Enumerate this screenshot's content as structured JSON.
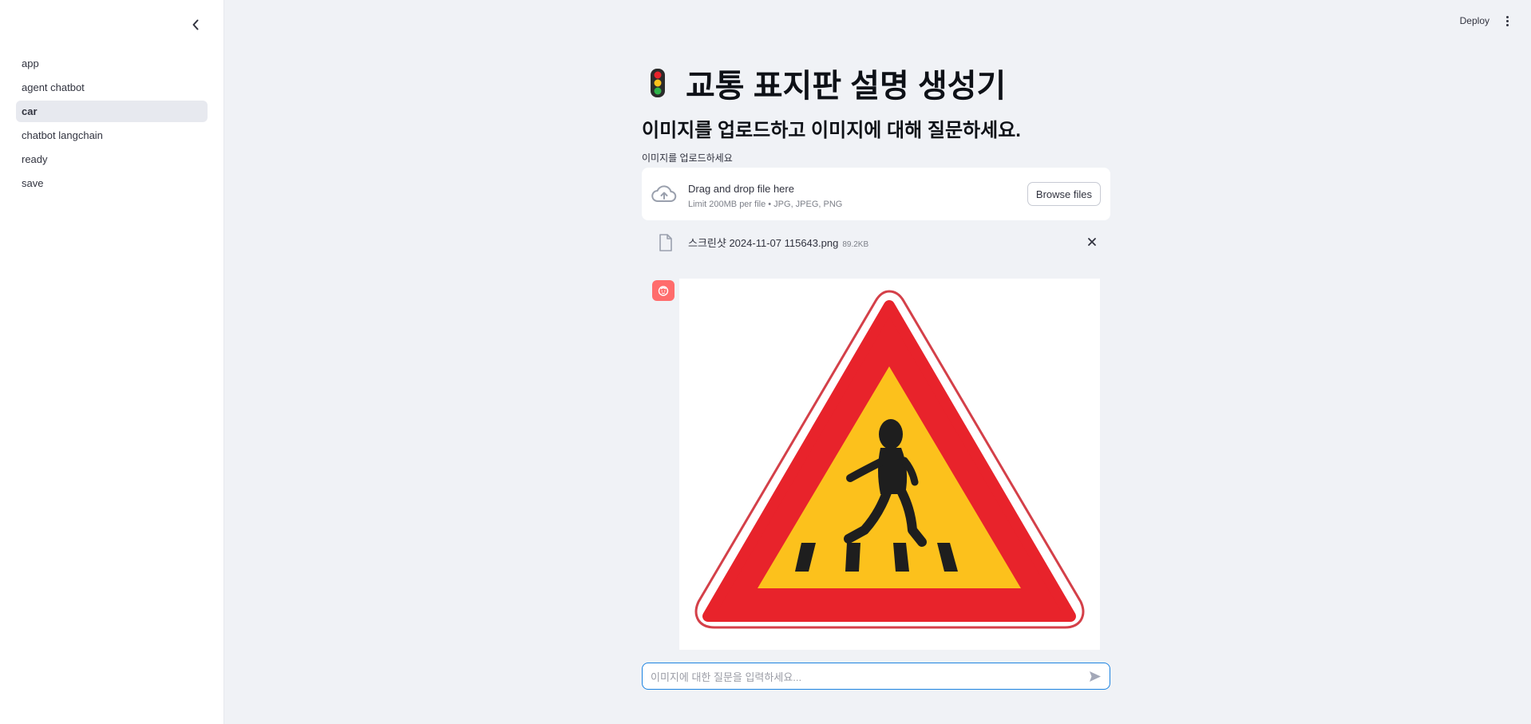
{
  "sidebar": {
    "items": [
      {
        "label": "app",
        "active": false
      },
      {
        "label": "agent chatbot",
        "active": false
      },
      {
        "label": "car",
        "active": true
      },
      {
        "label": "chatbot langchain",
        "active": false
      },
      {
        "label": "ready",
        "active": false
      },
      {
        "label": "save",
        "active": false
      }
    ]
  },
  "header": {
    "deploy_label": "Deploy"
  },
  "main": {
    "title": "교통 표지판 설명 생성기",
    "subtitle": "이미지를 업로드하고 이미지에 대해 질문하세요.",
    "uploader": {
      "label": "이미지를 업로드하세요",
      "drag_text": "Drag and drop file here",
      "limit_text": "Limit 200MB per file • JPG, JPEG, PNG",
      "browse_label": "Browse files"
    },
    "file": {
      "name": "스크린샷 2024-11-07 115643.png",
      "size": "89.2KB"
    },
    "chat_input": {
      "placeholder": "이미지에 대한 질문을 입력하세요...",
      "value": ""
    }
  },
  "colors": {
    "accent": "#1c83e1",
    "avatar": "#ff6c6c",
    "sign_red": "#e8232b",
    "sign_yellow": "#fcc11c",
    "background": "#f0f2f6"
  },
  "icons": [
    "chevron-left-icon",
    "more-vertical-icon",
    "cloud-upload-icon",
    "file-icon",
    "close-icon",
    "bot-avatar-icon",
    "send-icon",
    "traffic-light-icon"
  ]
}
